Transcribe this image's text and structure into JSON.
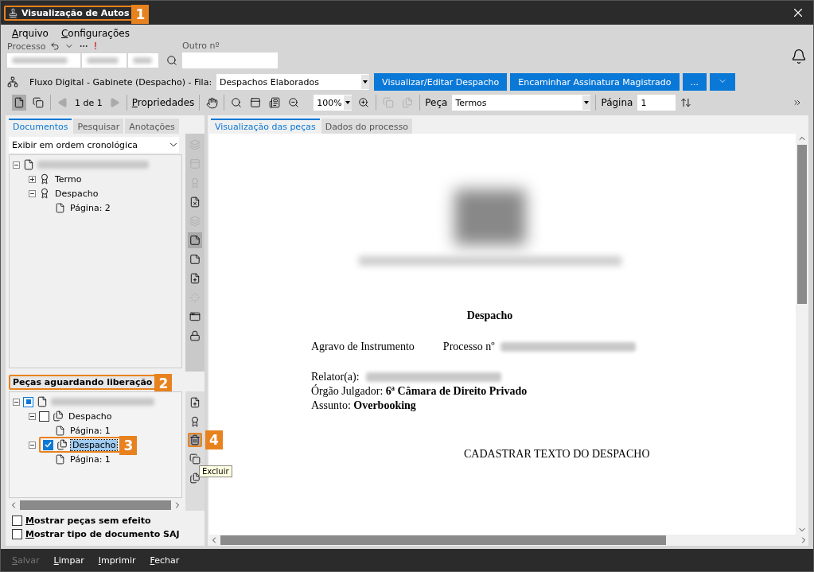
{
  "window": {
    "title": "Visualização de Autos",
    "callout": "1"
  },
  "menu": [
    "Arquivo",
    "Configurações"
  ],
  "process": {
    "label": "Processo",
    "alert": "!",
    "other_label": "Outro nº"
  },
  "flow": {
    "label": "Fluxo Digital - Gabinete (Despacho) - Fila:",
    "queue": "Despachos Elaborados",
    "buttons": [
      "Visualizar/Editar Despacho",
      "Encaminhar Assinatura Magistrado",
      "..."
    ]
  },
  "toolbar": {
    "page_counter": "1 de 1",
    "properties": "Propriedades",
    "zoom": "100%",
    "piece_label": "Peça",
    "piece": "Termos",
    "page_label": "Página",
    "page": "1"
  },
  "left_tabs": [
    {
      "label": "Documentos",
      "selected": true
    },
    {
      "label": "Pesquisar",
      "selected": false
    },
    {
      "label": "Anotações",
      "selected": false
    }
  ],
  "order_select": "Exibir em ordem cronológica",
  "doc_tree": [
    {
      "kind": "process",
      "expanded": true,
      "children": [
        {
          "kind": "signed",
          "label": "Termo",
          "expanded": false
        },
        {
          "kind": "signed",
          "label": "Despacho",
          "expanded": true,
          "children": [
            {
              "kind": "page",
              "label": "Página: 2"
            }
          ]
        }
      ]
    }
  ],
  "pending": {
    "title": "Peças aguardando liberação",
    "callout": "2",
    "tree": [
      {
        "kind": "process",
        "expanded": true,
        "indeterminate": true,
        "children": [
          {
            "kind": "piece",
            "label": "Despacho",
            "expanded": true,
            "checked": false,
            "selected": false,
            "children": [
              {
                "kind": "page",
                "label": "Página: 1"
              }
            ]
          },
          {
            "kind": "piece",
            "label": "Despacho",
            "expanded": true,
            "checked": true,
            "selected": true,
            "callout": "3",
            "children": [
              {
                "kind": "page",
                "label": "Página: 1"
              }
            ]
          }
        ]
      }
    ],
    "delete_callout": "4",
    "tooltip": "Excluir"
  },
  "options": [
    {
      "label": "Mostrar peças sem efeito",
      "checked": false
    },
    {
      "label": "Mostrar tipo de documento SAJ",
      "checked": false
    }
  ],
  "doc_tabs": [
    {
      "label": "Visualização das peças",
      "selected": true
    },
    {
      "label": "Dados do processo",
      "selected": false
    }
  ],
  "document": {
    "title": "Despacho",
    "class_label": "Agravo de Instrumento",
    "process_label": "Processo nº",
    "relator_label": "Relator(a):",
    "organ": "Órgão Julgador: **6ª Câmara de Direito Privado**",
    "subject": "Assunto: **Overbooking**",
    "body": "CADASTRAR TEXTO DO DESPACHO"
  },
  "footer": [
    {
      "label": "Salvar",
      "disabled": true
    },
    {
      "label": "Limpar",
      "disabled": false
    },
    {
      "label": "Imprimir",
      "disabled": false
    },
    {
      "label": "Fechar",
      "disabled": false
    }
  ]
}
